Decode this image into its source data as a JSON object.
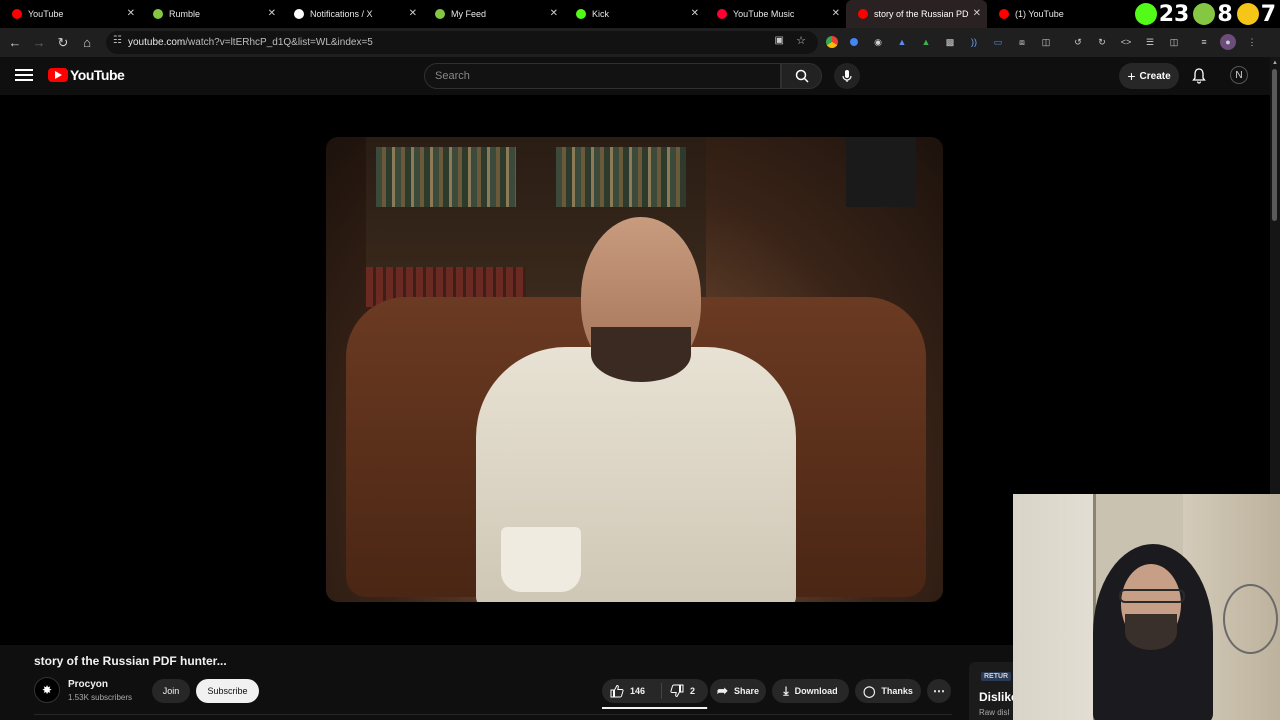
{
  "tabs": [
    {
      "label": "YouTube",
      "color": "#ff0000",
      "active": false
    },
    {
      "label": "Rumble",
      "color": "#85c742",
      "active": false
    },
    {
      "label": "Notifications / X",
      "color": "#ffffff",
      "active": false
    },
    {
      "label": "My Feed",
      "color": "#85c742",
      "active": false
    },
    {
      "label": "Kick",
      "color": "#53fc18",
      "active": false
    },
    {
      "label": "YouTube Music",
      "color": "#ff0033",
      "active": false
    },
    {
      "label": "story of the Russian PDF h",
      "color": "#ff0000",
      "active": true
    },
    {
      "label": "(1) YouTube",
      "color": "#ff0000",
      "active": false
    }
  ],
  "counters": [
    {
      "value": "23",
      "icon": "kick-icon",
      "color": "#53fc18"
    },
    {
      "value": "8",
      "icon": "rumble-icon",
      "color": "#85c742"
    },
    {
      "value": "7",
      "icon": "other-platform-icon",
      "color": "#f5c518"
    }
  ],
  "address": {
    "host": "youtube.com",
    "path": "/watch?v=ltERhcP_d1Q&list=WL&index=5"
  },
  "header": {
    "logo_text": "YouTube",
    "search_placeholder": "Search",
    "create_label": "Create",
    "avatar_letter": "N"
  },
  "video": {
    "title": "story of the Russian PDF hunter...",
    "channel": "Procyon",
    "subscribers": "1.53K subscribers",
    "join_label": "Join",
    "subscribe_label": "Subscribe",
    "likes": "146",
    "dislikes": "2",
    "like_ratio": 0.986,
    "share_label": "Share",
    "download_label": "Download",
    "thanks_label": "Thanks"
  },
  "ryd_panel": {
    "badge": "RETUR",
    "heading": "Dislike",
    "sub": "Raw disl"
  },
  "colors": {
    "accent": "#ff0000",
    "background": "#0f0f0f",
    "button": "#272727"
  }
}
